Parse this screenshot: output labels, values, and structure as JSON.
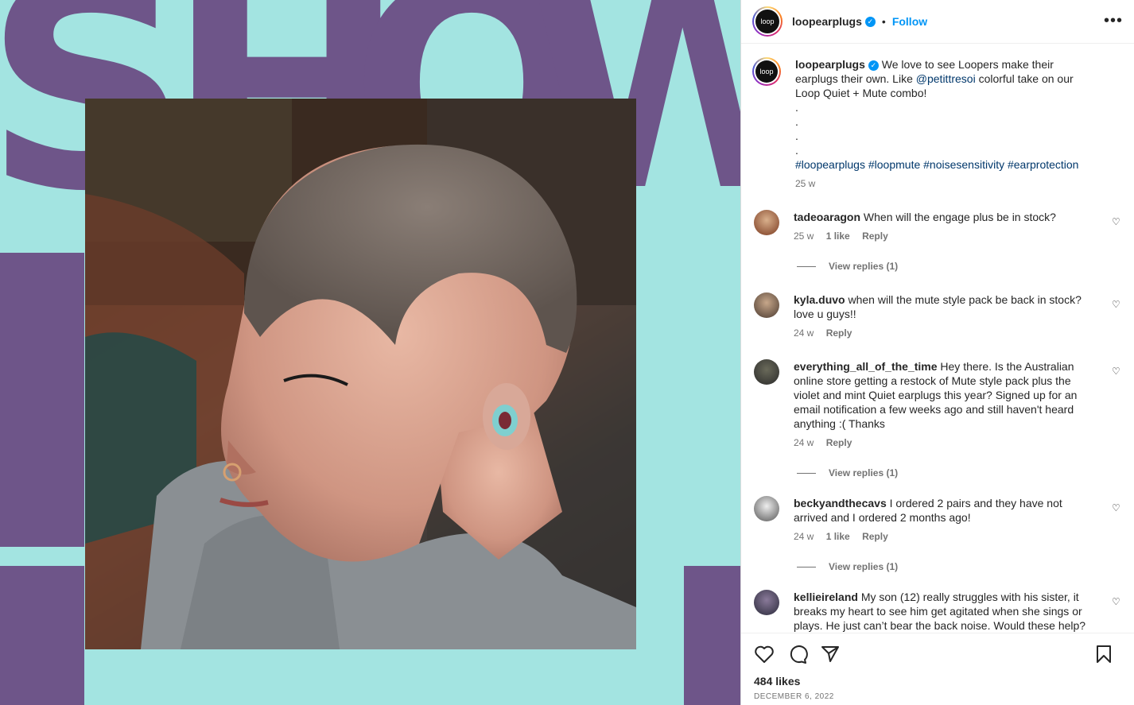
{
  "media": {
    "background_letters": [
      "S",
      "H",
      "O",
      "W"
    ],
    "colors": {
      "background": "#a3e4e1",
      "letters": "#6e5589"
    }
  },
  "header": {
    "avatar_text": "loop",
    "username": "loopearplugs",
    "separator": "•",
    "follow_label": "Follow",
    "more_label": "•••"
  },
  "caption": {
    "username": "loopearplugs",
    "text_before": "We love to see Loopers make their earplugs their own. Like ",
    "mention": "@petittresoi",
    "text_after": " colorful take on our Loop Quiet + Mute combo!",
    "dots": [
      ".",
      ".",
      ".",
      "."
    ],
    "hashtags": [
      "#loopearplugs",
      "#loopmute",
      "#noisesensitivity",
      "#earprotection"
    ],
    "time": "25 w"
  },
  "comments": [
    {
      "username": "tadeoaragon",
      "text": "When will the engage plus be in stock?",
      "time": "25 w",
      "likes": "1 like",
      "reply": "Reply",
      "view_replies": "View replies (1)"
    },
    {
      "username": "kyla.duvo",
      "text": "when will the mute style pack be back in stock? love u guys!!",
      "time": "24 w",
      "likes": "",
      "reply": "Reply",
      "view_replies": ""
    },
    {
      "username": "everything_all_of_the_time",
      "text": "Hey there. Is the Australian online store getting a restock of Mute style pack plus the violet and mint Quiet earplugs this year? Signed up for an email notification a few weeks ago and still haven't heard anything :( Thanks",
      "time": "24 w",
      "likes": "",
      "reply": "Reply",
      "view_replies": "View replies (1)"
    },
    {
      "username": "beckyandthecavs",
      "text": "I ordered 2 pairs and they have not arrived and I ordered 2 months ago!",
      "time": "24 w",
      "likes": "1 like",
      "reply": "Reply",
      "view_replies": "View replies (1)"
    },
    {
      "username": "kellieireland",
      "text": "My son (12) really struggles with his sister, it breaks my heart to see him get agitated when she sings or plays. He just can’t bear the back noise. Would these help?",
      "time": "",
      "likes": "",
      "reply": "",
      "view_replies": ""
    }
  ],
  "footer": {
    "likes": "484 likes",
    "date": "DECEMBER 6, 2022"
  }
}
